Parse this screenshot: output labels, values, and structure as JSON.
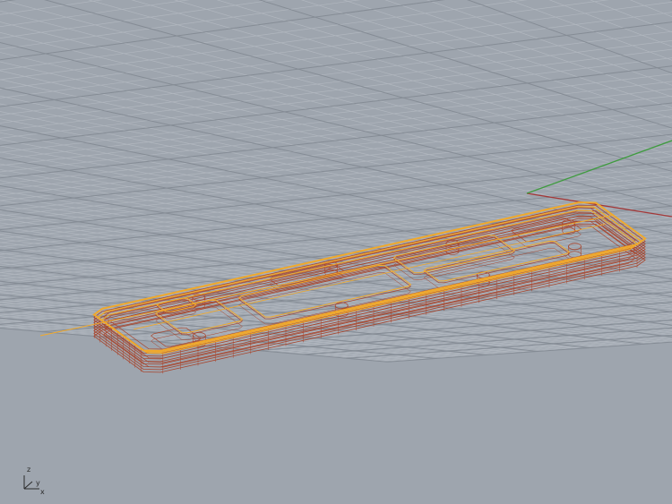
{
  "viewport": {
    "background_color": "#9ea5ae",
    "grid_minor_color": "#b1b7bf",
    "grid_major_color": "#858c95",
    "world_x_axis_color": "#a33838",
    "world_y_axis_color": "#3f9b3f",
    "model_edge_color": "#a8462e",
    "model_selection_color": "#f0a92c",
    "axis_widget": {
      "z_label": "z",
      "y_label": "y",
      "x_label": "x"
    }
  }
}
